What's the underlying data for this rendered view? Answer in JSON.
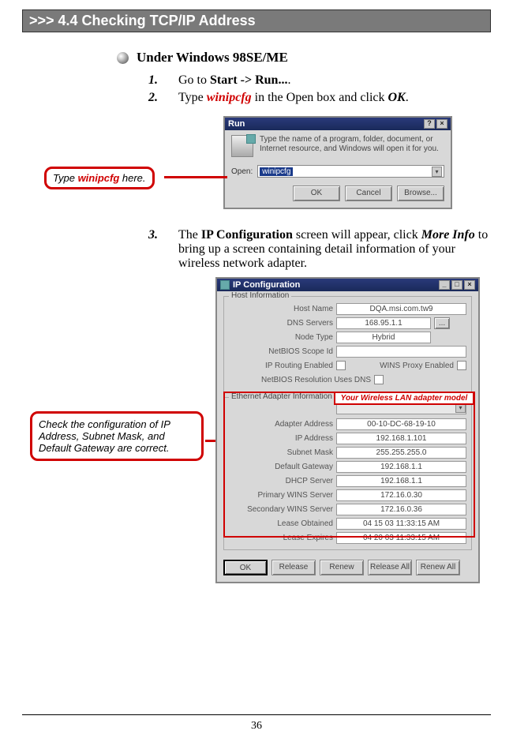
{
  "section_title": ">>> 4.4  Checking TCP/IP Address",
  "subhead": "Under Windows 98SE/ME",
  "steps": [
    {
      "num": "1.",
      "pre": "Go to ",
      "strong": "Start -> Run...",
      "post": "."
    },
    {
      "num": "2.",
      "pre": "Type ",
      "red": "winipcfg",
      "mid": " in the Open box and click ",
      "strong": "OK",
      "post": "."
    }
  ],
  "callout1": {
    "pre": "Type ",
    "red": "winipcfg",
    "post": " here."
  },
  "run": {
    "title": "Run",
    "help": "?",
    "close": "×",
    "desc": "Type the name of a program, folder, document, or Internet resource, and Windows will open it for you.",
    "open_label": "Open:",
    "input_value": "winipcfg",
    "btn_ok": "OK",
    "btn_cancel": "Cancel",
    "btn_browse": "Browse..."
  },
  "step3": {
    "num": "3.",
    "pre": "The ",
    "strong1": "IP Configuration",
    "mid": " screen will appear, click ",
    "strong2": "More Info",
    "post": " to bring up a screen containing detail information of your wireless network adapter."
  },
  "callout2": "Check the configuration of IP Address, Subnet Mask, and Default Gateway are correct.",
  "adapter_callout": "Your Wireless LAN adapter model",
  "ipcfg": {
    "title": "IP Configuration",
    "min": "_",
    "max": "□",
    "close": "×",
    "host_group": "Host Information",
    "eth_group": "Ethernet Adapter Information",
    "fields_host": {
      "host_name": {
        "label": "Host Name",
        "value": "DQA.msi.com.tw9"
      },
      "dns": {
        "label": "DNS Servers",
        "value": "168.95.1.1"
      },
      "node": {
        "label": "Node Type",
        "value": "Hybrid"
      },
      "scope": {
        "label": "NetBIOS Scope Id",
        "value": ""
      },
      "iprouting": {
        "label": "IP Routing Enabled",
        "value": ""
      },
      "winsproxy": {
        "label": "WINS Proxy Enabled",
        "value": ""
      },
      "netbiosdns": {
        "label": "NetBIOS Resolution Uses DNS",
        "value": ""
      }
    },
    "fields_eth": {
      "adapter_addr": {
        "label": "Adapter Address",
        "value": "00-10-DC-68-19-10"
      },
      "ip_addr": {
        "label": "IP Address",
        "value": "192.168.1.101"
      },
      "subnet": {
        "label": "Subnet Mask",
        "value": "255.255.255.0"
      },
      "gateway": {
        "label": "Default Gateway",
        "value": "192.168.1.1"
      },
      "dhcp": {
        "label": "DHCP Server",
        "value": "192.168.1.1"
      },
      "pwins": {
        "label": "Primary WINS Server",
        "value": "172.16.0.30"
      },
      "swins": {
        "label": "Secondary WINS Server",
        "value": "172.16.0.36"
      },
      "lobt": {
        "label": "Lease Obtained",
        "value": "04 15 03 11:33:15 AM"
      },
      "lexp": {
        "label": "Lease Expires",
        "value": "04 20 03 11:33:15 AM"
      }
    },
    "buttons": {
      "ok": "OK",
      "release": "Release",
      "renew": "Renew",
      "release_all": "Release All",
      "renew_all": "Renew All"
    }
  },
  "page_number": "36"
}
